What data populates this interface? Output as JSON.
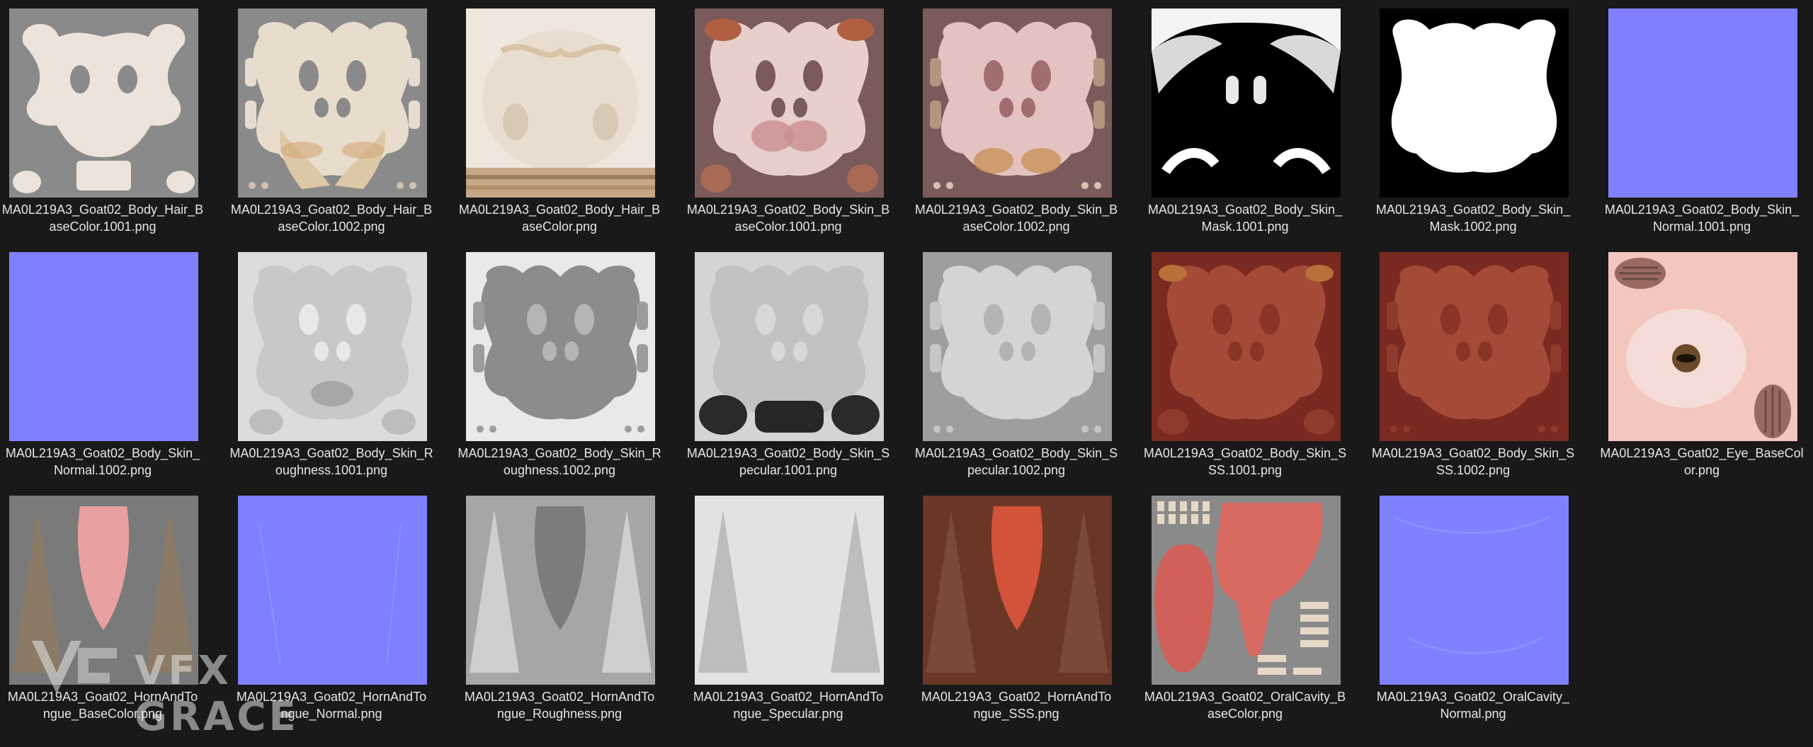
{
  "files": [
    {
      "name": "MA0L219A3_Goat02_Body_Hair_BaseColor.1001.png",
      "line1": "MA0L219A3_Goat02_Body_Hair_B",
      "line2": "aseColor.1001.png",
      "kind": "hair1"
    },
    {
      "name": "MA0L219A3_Goat02_Body_Hair_BaseColor.1002.png",
      "line1": "MA0L219A3_Goat02_Body_Hair_B",
      "line2": "aseColor.1002.png",
      "kind": "hair2"
    },
    {
      "name": "MA0L219A3_Goat02_Body_Hair_BaseColor.png",
      "line1": "MA0L219A3_Goat02_Body_Hair_B",
      "line2": "aseColor.png",
      "kind": "hair3"
    },
    {
      "name": "MA0L219A3_Goat02_Body_Skin_BaseColor.1001.png",
      "line1": "MA0L219A3_Goat02_Body_Skin_B",
      "line2": "aseColor.1001.png",
      "kind": "skin1"
    },
    {
      "name": "MA0L219A3_Goat02_Body_Skin_BaseColor.1002.png",
      "line1": "MA0L219A3_Goat02_Body_Skin_B",
      "line2": "aseColor.1002.png",
      "kind": "skin2"
    },
    {
      "name": "MA0L219A3_Goat02_Body_Skin_Mask.1001.png",
      "line1": "MA0L219A3_Goat02_Body_Skin_",
      "line2": "Mask.1001.png",
      "kind": "mask1"
    },
    {
      "name": "MA0L219A3_Goat02_Body_Skin_Mask.1002.png",
      "line1": "MA0L219A3_Goat02_Body_Skin_",
      "line2": "Mask.1002.png",
      "kind": "mask2"
    },
    {
      "name": "MA0L219A3_Goat02_Body_Skin_Normal.1001.png",
      "line1": "MA0L219A3_Goat02_Body_Skin_",
      "line2": "Normal.1001.png",
      "kind": "normal"
    },
    {
      "name": "MA0L219A3_Goat02_Body_Skin_Normal.1002.png",
      "line1": "MA0L219A3_Goat02_Body_Skin_",
      "line2": "Normal.1002.png",
      "kind": "normal"
    },
    {
      "name": "MA0L219A3_Goat02_Body_Skin_Roughness.1001.png",
      "line1": "MA0L219A3_Goat02_Body_Skin_R",
      "line2": "oughness.1001.png",
      "kind": "rough1"
    },
    {
      "name": "MA0L219A3_Goat02_Body_Skin_Roughness.1002.png",
      "line1": "MA0L219A3_Goat02_Body_Skin_R",
      "line2": "oughness.1002.png",
      "kind": "rough2"
    },
    {
      "name": "MA0L219A3_Goat02_Body_Skin_Specular.1001.png",
      "line1": "MA0L219A3_Goat02_Body_Skin_S",
      "line2": "pecular.1001.png",
      "kind": "spec1"
    },
    {
      "name": "MA0L219A3_Goat02_Body_Skin_Specular.1002.png",
      "line1": "MA0L219A3_Goat02_Body_Skin_S",
      "line2": "pecular.1002.png",
      "kind": "spec2"
    },
    {
      "name": "MA0L219A3_Goat02_Body_Skin_SSS.1001.png",
      "line1": "MA0L219A3_Goat02_Body_Skin_S",
      "line2": "SS.1001.png",
      "kind": "sss1"
    },
    {
      "name": "MA0L219A3_Goat02_Body_Skin_SSS.1002.png",
      "line1": "MA0L219A3_Goat02_Body_Skin_S",
      "line2": "SS.1002.png",
      "kind": "sss2"
    },
    {
      "name": "MA0L219A3_Goat02_Eye_BaseColor.png",
      "line1": "MA0L219A3_Goat02_Eye_BaseCol",
      "line2": "or.png",
      "kind": "eye"
    },
    {
      "name": "MA0L219A3_Goat02_HornAndTongue_BaseColor.png",
      "line1": "MA0L219A3_Goat02_HornAndTo",
      "line2": "ngue_BaseColor.png",
      "kind": "horn_base"
    },
    {
      "name": "MA0L219A3_Goat02_HornAndTongue_Normal.png",
      "line1": "MA0L219A3_Goat02_HornAndTo",
      "line2": "ngue_Normal.png",
      "kind": "normal2"
    },
    {
      "name": "MA0L219A3_Goat02_HornAndTongue_Roughness.png",
      "line1": "MA0L219A3_Goat02_HornAndTo",
      "line2": "ngue_Roughness.png",
      "kind": "horn_rough"
    },
    {
      "name": "MA0L219A3_Goat02_HornAndTongue_Specular.png",
      "line1": "MA0L219A3_Goat02_HornAndTo",
      "line2": "ngue_Specular.png",
      "kind": "horn_spec"
    },
    {
      "name": "MA0L219A3_Goat02_HornAndTongue_SSS.png",
      "line1": "MA0L219A3_Goat02_HornAndTo",
      "line2": "ngue_SSS.png",
      "kind": "horn_sss"
    },
    {
      "name": "MA0L219A3_Goat02_OralCavity_BaseColor.png",
      "line1": "MA0L219A3_Goat02_OralCavity_B",
      "line2": "aseColor.png",
      "kind": "oral"
    },
    {
      "name": "MA0L219A3_Goat02_OralCavity_Normal.png",
      "line1": "MA0L219A3_Goat02_OralCavity_",
      "line2": "Normal.png",
      "kind": "normal3"
    }
  ],
  "watermark": {
    "text": "VFX GRACE",
    "icon": "vfx-grace-logo-icon"
  },
  "colors": {
    "background": "#191919",
    "label": "#e6e6e6",
    "normal_map": "#7f7fff"
  }
}
